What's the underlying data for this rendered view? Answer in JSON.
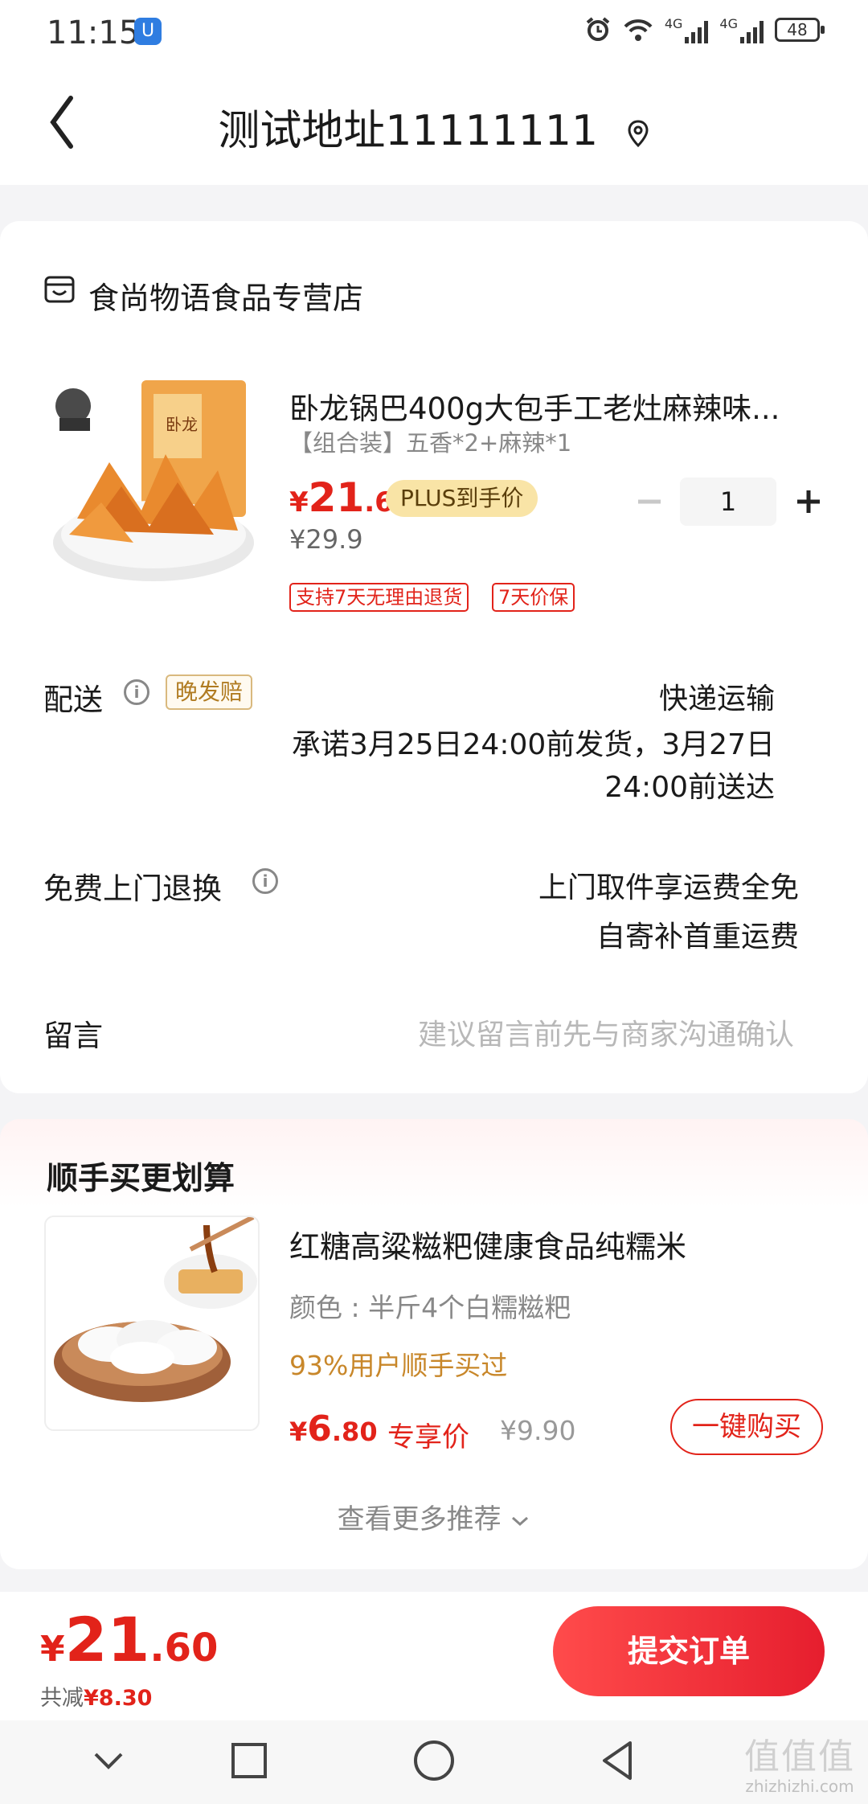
{
  "status_bar": {
    "time": "11:15",
    "badge": "U",
    "network1": "4G",
    "network2": "4G",
    "battery": "48"
  },
  "header": {
    "title": "测试地址11111111"
  },
  "store": {
    "name": "食尚物语食品专营店"
  },
  "product": {
    "title": "卧龙锅巴400g大包手工老灶麻辣味...",
    "spec": "【组合装】五香*2+麻辣*1",
    "price_yen": "¥",
    "price_int": "21",
    "price_dec": ".6",
    "plus_tag": "PLUS到手价",
    "original_price": "¥29.9",
    "quantity": "1",
    "tags": [
      "支持7天无理由退货",
      "7天价保"
    ]
  },
  "delivery": {
    "label": "配送",
    "late_tag": "晚发赔",
    "method": "快递运输",
    "promise_line1": "承诺3月25日24:00前发货，3月27日",
    "promise_line2": "24:00前送达"
  },
  "free_return": {
    "label": "免费上门退换",
    "line1": "上门取件享运费全免",
    "line2": "自寄补首重运费"
  },
  "remark": {
    "label": "留言",
    "placeholder": "建议留言前先与商家沟通确认"
  },
  "recommend": {
    "section_title": "顺手买更划算",
    "item_title": "红糖高粱糍粑健康食品纯糯米",
    "item_spec": "颜色 : 半斤4个白糯糍粑",
    "buyers": "93%用户顺手买过",
    "price_yen": "¥",
    "price_int": "6",
    "price_dec": ".80",
    "exclusive": "专享价",
    "original_price": "¥9.90",
    "buy_button": "一键购买",
    "more": "查看更多推荐"
  },
  "bottom": {
    "price_yen": "¥",
    "price_int": "21",
    "price_dec": ".60",
    "saved_label": "共减",
    "saved_amount": "¥8.30",
    "submit": "提交订单"
  },
  "watermark": {
    "logo": "值值值",
    "site": "zhizhizhi.com"
  },
  "colors": {
    "accent": "#e2231a",
    "plus_bg": "#f9e4a6",
    "orange_text": "#c8872a"
  }
}
